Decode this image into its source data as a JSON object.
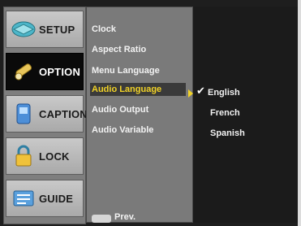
{
  "sidebar": {
    "items": [
      {
        "label": "SETUP",
        "icon": "setup-icon",
        "active": false
      },
      {
        "label": "OPTION",
        "icon": "option-icon",
        "active": true
      },
      {
        "label": "CAPTION",
        "icon": "caption-icon",
        "active": false
      },
      {
        "label": "LOCK",
        "icon": "lock-icon",
        "active": false
      },
      {
        "label": "GUIDE",
        "icon": "guide-icon",
        "active": false
      }
    ]
  },
  "menu": {
    "items": [
      "Clock",
      "Aspect Ratio",
      "Menu Language",
      "Audio Language",
      "Audio Output",
      "Audio Variable"
    ],
    "selected": "Audio Language",
    "prev_label": "Prev."
  },
  "submenu": {
    "options": [
      "English",
      "French",
      "Spanish"
    ],
    "checked": "English"
  },
  "colors": {
    "highlight_text": "#f1d227",
    "sidebar_bg": "#7e7e7e",
    "menu_bg": "#7a7a7a",
    "active_tab": "#0a0a0a"
  }
}
